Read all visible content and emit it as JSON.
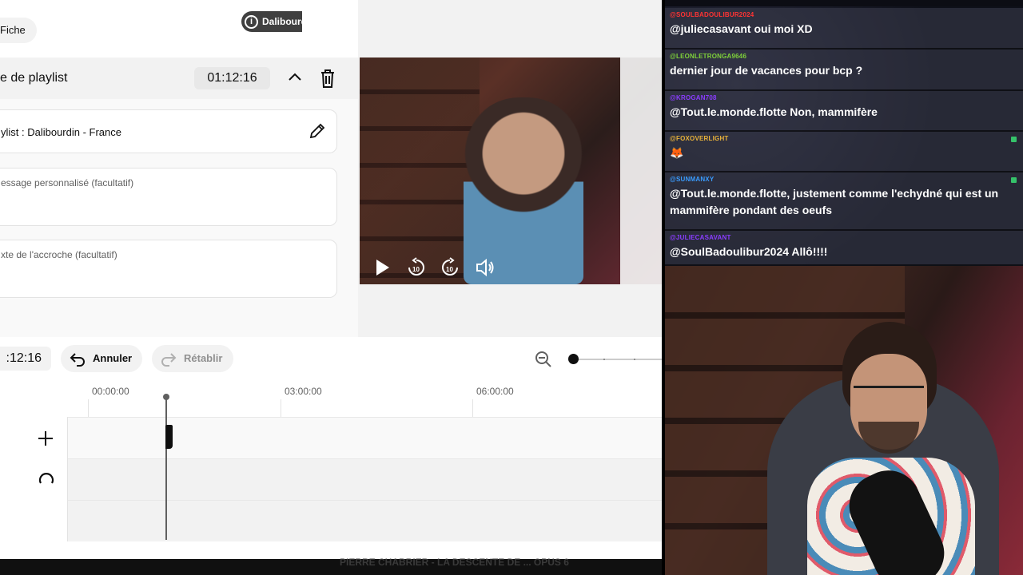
{
  "editor": {
    "fiche_label": "Fiche",
    "playlist_header": {
      "title": "e de playlist",
      "time": "01:12:16"
    },
    "fields": {
      "playlist_value": "ylist : Dalibourdin - France",
      "message_placeholder": "essage personnalisé (facultatif)",
      "hook_placeholder": "xte de l'accroche (facultatif)"
    },
    "video": {
      "badge_label": "Dalibourd",
      "badge_icon": "info-icon",
      "controls": [
        "play-icon",
        "rewind-10-icon",
        "forward-10-icon",
        "volume-icon"
      ]
    },
    "toolbar": {
      "time": ":12:16",
      "undo_label": "Annuler",
      "redo_label": "Rétablir"
    },
    "timeline": {
      "ruler": [
        "00:00:00",
        "03:00:00",
        "06:00:00"
      ]
    },
    "caption": "PIERRE CHABRIER - LA DESCENTE DE ... OPUS 6"
  },
  "chat": {
    "messages": [
      {
        "user": "@SOULBADOULIBUR2024",
        "user_color": "#ff3333",
        "text": "@juliecasavant oui moi XD"
      },
      {
        "user": "@LEONLETRONGA9646",
        "user_color": "#7fd23a",
        "text": "dernier jour de vacances pour bcp ?"
      },
      {
        "user": "@KROGAN708",
        "user_color": "#8a3cff",
        "text": "@Tout.le.monde.flotte Non, mammifère"
      },
      {
        "user": "@FOXOVERLIGHT",
        "user_color": "#e8b23a",
        "text": "🦊"
      },
      {
        "user": "@SUNMANXY",
        "user_color": "#3a9cff",
        "text": "@Tout.le.monde.flotte, justement comme l'echydné qui est un mammifère pondant des oeufs"
      },
      {
        "user": "@JULIECASAVANT",
        "user_color": "#8a3cff",
        "text": "@SoulBadoulibur2024 Allô!!!!"
      }
    ]
  }
}
